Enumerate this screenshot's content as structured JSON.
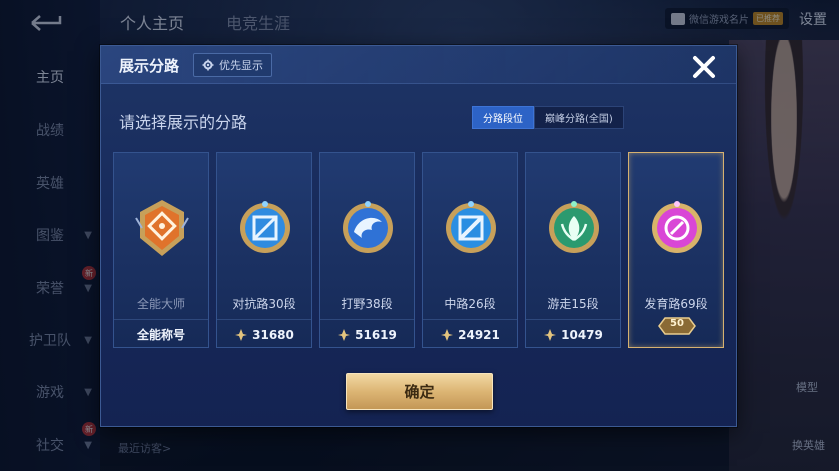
{
  "background": {
    "nav": [
      {
        "label": "主页",
        "active": true
      },
      {
        "label": "战绩"
      },
      {
        "label": "英雄"
      },
      {
        "label": "图鉴",
        "chevron": true
      },
      {
        "label": "荣誉",
        "chevron": true,
        "badge": "新"
      },
      {
        "label": "护卫队",
        "chevron": true
      },
      {
        "label": "游戏",
        "chevron": true
      },
      {
        "label": "社交",
        "chevron": true,
        "badge": "新"
      }
    ],
    "tabs": [
      "个人主页",
      "电竞生涯"
    ],
    "wechat_label": "微信游戏名片",
    "rec_badge": "已推荐",
    "settings": "设置",
    "recent_visitors": "最近访客>",
    "model_btn": "模型",
    "swap_hero_btn": "换英雄"
  },
  "modal": {
    "title": "展示分路",
    "priority_label": "优先显示",
    "subtitle": "请选择展示的分路",
    "filters": [
      {
        "label": "分路段位",
        "active": true
      },
      {
        "label": "巅峰分路(全国)",
        "active": false
      }
    ],
    "cards": [
      {
        "id": "all",
        "label": "全能大师",
        "foot": "全能称号",
        "gem": "#e0732b",
        "rim": "#c7a05a",
        "selected": false
      },
      {
        "id": "top",
        "label": "对抗路30段",
        "power": "31680",
        "gem": "#2f8be0",
        "rim": "#c7a05a",
        "selected": false
      },
      {
        "id": "jungle",
        "label": "打野38段",
        "power": "51619",
        "gem": "#2f72d6",
        "rim": "#c7a05a",
        "selected": false
      },
      {
        "id": "mid",
        "label": "中路26段",
        "power": "24921",
        "gem": "#2a8ee2",
        "rim": "#c7a05a",
        "selected": false
      },
      {
        "id": "roam",
        "label": "游走15段",
        "power": "10479",
        "gem": "#2b9a6f",
        "rim": "#c7a05a",
        "selected": false
      },
      {
        "id": "adc",
        "label": "发育路69段",
        "level_badge": "50",
        "gem": "#d946d6",
        "rim": "#d8b36a",
        "selected": true
      }
    ],
    "confirm_label": "确定"
  },
  "colors": {
    "accent_blue": "#2d63c6",
    "gold": "#dcb574",
    "panel": "#1e3566"
  }
}
